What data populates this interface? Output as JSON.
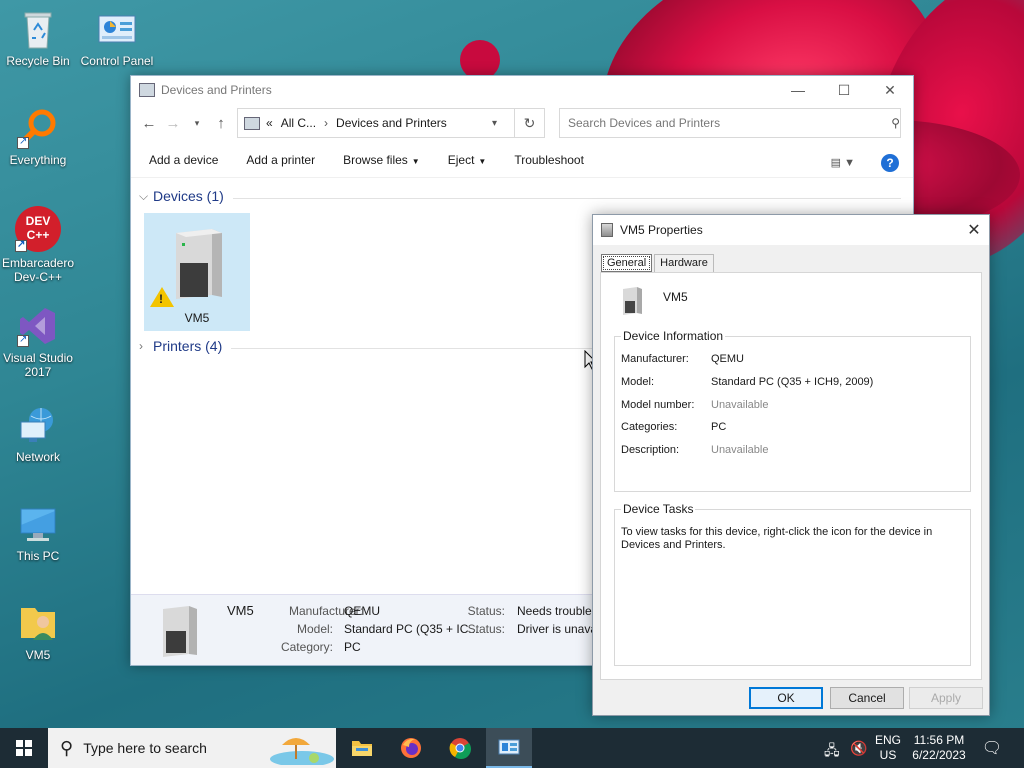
{
  "desktop": {
    "icons": [
      {
        "label": "Recycle Bin"
      },
      {
        "label": "Control Panel"
      },
      {
        "label": "Everything"
      },
      {
        "label": "Embarcadero Dev-C++"
      },
      {
        "label": "Visual Studio 2017"
      },
      {
        "label": "Network"
      },
      {
        "label": "This PC"
      },
      {
        "label": "VM5"
      }
    ],
    "devcpp_logo_top": "DEV",
    "devcpp_logo_bottom": "C++"
  },
  "explorer": {
    "title": "Devices and Printers",
    "breadcrumb": {
      "overflow": "«",
      "parent": "All C...",
      "separator": "›",
      "current": "Devices and Printers"
    },
    "search_placeholder": "Search Devices and Printers",
    "commands": [
      {
        "label": "Add a device"
      },
      {
        "label": "Add a printer"
      },
      {
        "label": "Browse files"
      },
      {
        "label": "Eject"
      },
      {
        "label": "Troubleshoot"
      }
    ],
    "help_label": "?",
    "groups": {
      "devices": "Devices (1)",
      "printers": "Printers (4)"
    },
    "device_tile_label": "VM5",
    "details": {
      "name": "VM5",
      "manufacturer_label": "Manufacturer:",
      "manufacturer": "QEMU",
      "model_label": "Model:",
      "model": "Standard PC (Q35 + IC...",
      "category_label": "Category:",
      "category": "PC",
      "status_label": "Status:",
      "status1": "Needs troubles",
      "status2": "Driver is unava"
    }
  },
  "dialog": {
    "title": "VM5 Properties",
    "tabs": [
      {
        "label": "General"
      },
      {
        "label": "Hardware"
      }
    ],
    "device_name": "VM5",
    "device_info_title": "Device Information",
    "props": [
      {
        "key": "Manufacturer:",
        "value": "QEMU",
        "muted": false
      },
      {
        "key": "Model:",
        "value": "Standard PC (Q35 + ICH9, 2009)",
        "muted": false
      },
      {
        "key": "Model number:",
        "value": "Unavailable",
        "muted": true
      },
      {
        "key": "Categories:",
        "value": "PC",
        "muted": false
      },
      {
        "key": "Description:",
        "value": "Unavailable",
        "muted": true
      }
    ],
    "tasks_title": "Device Tasks",
    "tasks_text": "To view tasks for this device, right-click the icon for the device in Devices and Printers.",
    "buttons": {
      "ok": "OK",
      "cancel": "Cancel",
      "apply": "Apply"
    }
  },
  "taskbar": {
    "search_placeholder": "Type here to search",
    "lang_top": "ENG",
    "lang_bottom": "US",
    "time": "11:56 PM",
    "date": "6/22/2023"
  },
  "colors": {
    "accent": "#0078d7",
    "taskbar": "#1d2c35",
    "selection": "#cde8f7"
  }
}
